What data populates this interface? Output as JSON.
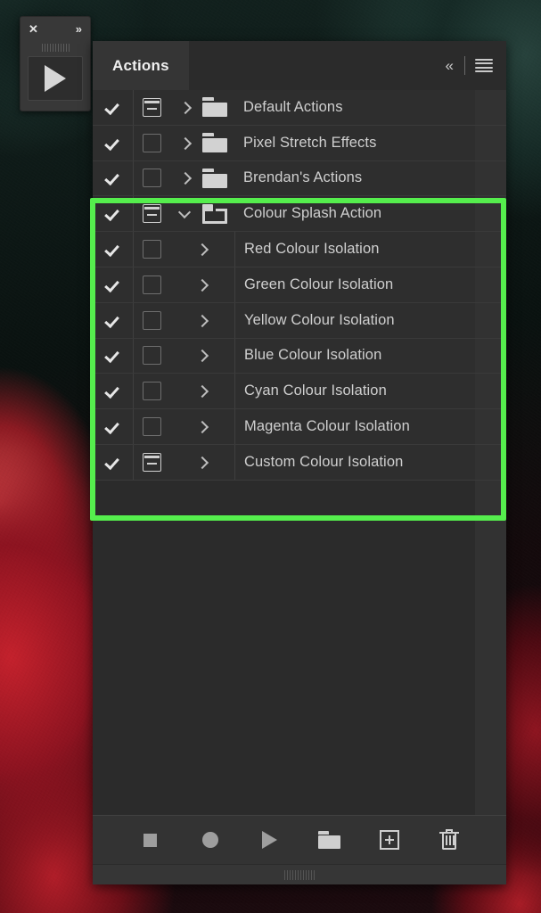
{
  "tool_strip": {
    "close_label": "✕",
    "expand_label": "»",
    "play_label": ""
  },
  "panel": {
    "tab_label": "Actions",
    "collapse_label": "«"
  },
  "rows": [
    {
      "label": "Default Actions",
      "checked": true,
      "dialog_on": true,
      "expanded": false,
      "type": "set"
    },
    {
      "label": "Pixel Stretch Effects",
      "checked": true,
      "dialog_on": false,
      "expanded": false,
      "type": "set"
    },
    {
      "label": "Brendan's Actions",
      "checked": true,
      "dialog_on": false,
      "expanded": false,
      "type": "set"
    },
    {
      "label": "Colour Splash Action",
      "checked": true,
      "dialog_on": true,
      "expanded": true,
      "type": "set"
    },
    {
      "label": "Red Colour Isolation",
      "checked": true,
      "dialog_on": false,
      "expanded": false,
      "type": "action"
    },
    {
      "label": "Green Colour Isolation",
      "checked": true,
      "dialog_on": false,
      "expanded": false,
      "type": "action"
    },
    {
      "label": "Yellow Colour Isolation",
      "checked": true,
      "dialog_on": false,
      "expanded": false,
      "type": "action"
    },
    {
      "label": "Blue Colour Isolation",
      "checked": true,
      "dialog_on": false,
      "expanded": false,
      "type": "action"
    },
    {
      "label": "Cyan Colour Isolation",
      "checked": true,
      "dialog_on": false,
      "expanded": false,
      "type": "action"
    },
    {
      "label": "Magenta Colour Isolation",
      "checked": true,
      "dialog_on": false,
      "expanded": false,
      "type": "action"
    },
    {
      "label": "Custom Colour Isolation",
      "checked": true,
      "dialog_on": true,
      "expanded": false,
      "type": "action"
    }
  ],
  "highlight": {
    "color": "#55ee4d",
    "first_row_index": 3,
    "last_row_index": 10
  },
  "footer": {
    "buttons": [
      {
        "name": "stop-playing-recording",
        "icon": "stop-icon"
      },
      {
        "name": "begin-recording",
        "icon": "record-icon"
      },
      {
        "name": "play-selection",
        "icon": "play-icon"
      },
      {
        "name": "create-new-set",
        "icon": "folder-icon"
      },
      {
        "name": "create-new-action",
        "icon": "plus-box-icon"
      },
      {
        "name": "delete",
        "icon": "trash-icon"
      }
    ]
  },
  "colors": {
    "panel_bg": "#2b2b2b",
    "row_bg": "#2e2e2e",
    "tab_bg": "#353535",
    "footer_bg": "#333333",
    "text": "#cfcfcf",
    "highlight": "#55ee4d"
  }
}
